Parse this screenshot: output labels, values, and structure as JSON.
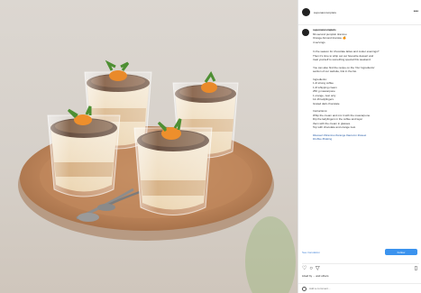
{
  "post": {
    "account": "suponancomplets",
    "caption_title": "suponancomplets",
    "caption_lines": [
      "60-second pumpkin tiramisu",
      "Orange Almond tiramisu 🍊",
      "4 servings"
    ],
    "body_lines": [
      "In the season for chocolate lattes and cooler evenings?",
      "Then it's time to whip out our favourite dessert and",
      "treat yourself to something special this weekend.",
      "",
      "You can also find the recipe on the 'Our Ingredients'",
      "section of our website, link in the bio.",
      "",
      "Ingredients:",
      "1 dl strong coffee",
      "1 dl whipping cream",
      "250 g mascarpone",
      "1 orange, zest only",
      "12-16 ladyfingers",
      "Grated dark chocolate",
      "",
      "Instructions:",
      "Whip the cream and mix it with the mascarpone.",
      "Dip the ladyfingers in the coffee and layer",
      "them with the cream in glasses.",
      "Top with chocolate and orange zest."
    ],
    "hashtags_lines": [
      "#dessert #tiramisu #orange #autumn #sweet",
      "#coffee #baking"
    ],
    "see_translation": "See translation",
    "follow_label": "Follow",
    "likes_text": "Liked by ... and others",
    "comment_placeholder": "Add a comment...",
    "icons": [
      "heart-icon",
      "comment-icon",
      "share-icon",
      "bookmark-icon",
      "more-icon",
      "emoji-icon"
    ]
  }
}
